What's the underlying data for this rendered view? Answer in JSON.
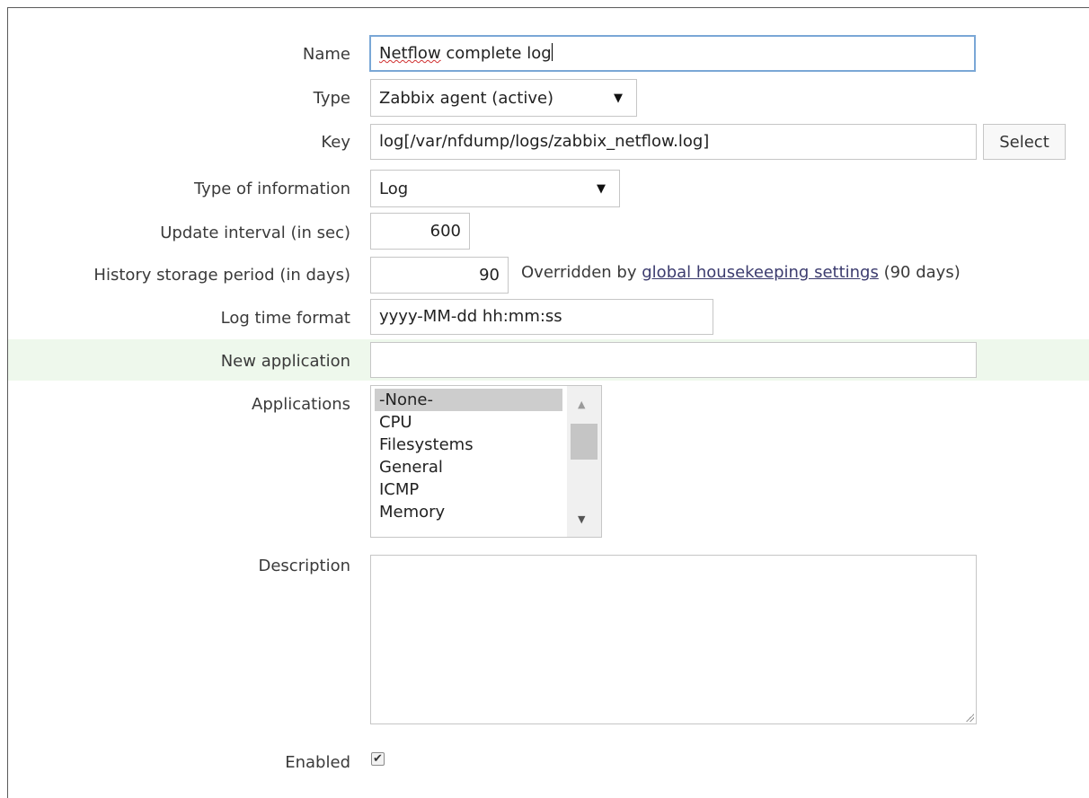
{
  "form": {
    "name": {
      "label": "Name",
      "value_word1": "Netflow",
      "value_rest": " complete log"
    },
    "type": {
      "label": "Type",
      "value": "Zabbix agent (active)",
      "arrow": "▼"
    },
    "key": {
      "label": "Key",
      "value": "log[/var/nfdump/logs/zabbix_netflow.log]",
      "button": "Select"
    },
    "type_of_information": {
      "label": "Type of information",
      "value": "Log",
      "arrow": "▼"
    },
    "update_interval": {
      "label": "Update interval (in sec)",
      "value": "600"
    },
    "history": {
      "label": "History storage period (in days)",
      "value": "90",
      "note_prefix": "Overridden by ",
      "note_link": "global housekeeping settings",
      "note_suffix": " (90 days)"
    },
    "log_time_format": {
      "label": "Log time format",
      "value": "yyyy-MM-dd hh:mm:ss"
    },
    "new_application": {
      "label": "New application",
      "value": ""
    },
    "applications": {
      "label": "Applications",
      "options": [
        "-None-",
        "CPU",
        "Filesystems",
        "General",
        "ICMP",
        "Memory"
      ],
      "selected": "-None-",
      "scroll_up": "▲",
      "scroll_down": "▼"
    },
    "description": {
      "label": "Description",
      "value": ""
    },
    "enabled": {
      "label": "Enabled",
      "checked": true,
      "mark": "✔"
    }
  },
  "colors": {
    "highlight_row": "#eef8ec",
    "link": "#3b3b6e",
    "focus_border": "#7aa7d6"
  }
}
